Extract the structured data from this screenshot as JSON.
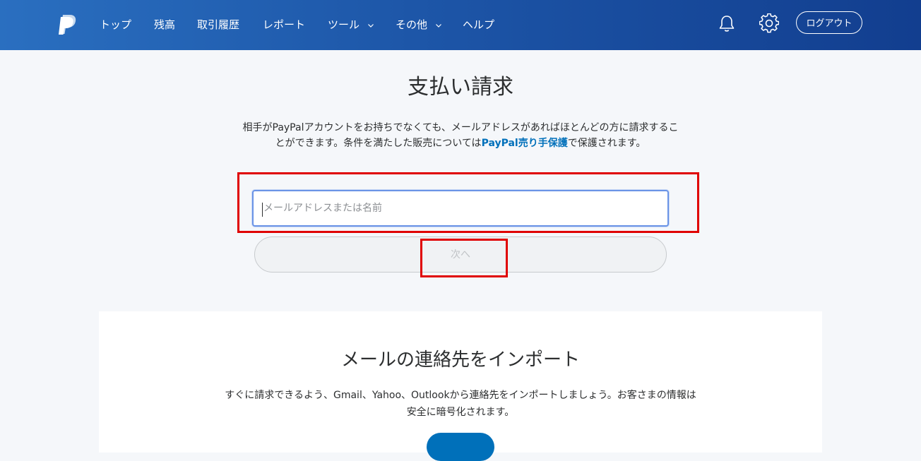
{
  "header": {
    "nav": [
      {
        "label": "トップ",
        "has_dropdown": false
      },
      {
        "label": "残高",
        "has_dropdown": false
      },
      {
        "label": "取引履歴",
        "has_dropdown": false
      },
      {
        "label": "レポート",
        "has_dropdown": false
      },
      {
        "label": "ツール",
        "has_dropdown": true
      },
      {
        "label": "その他",
        "has_dropdown": true
      },
      {
        "label": "ヘルプ",
        "has_dropdown": false
      }
    ],
    "icons": [
      "paypal-logo-icon",
      "bell-icon",
      "gear-icon",
      "chevron-down-icon"
    ],
    "logout_label": "ログアウト"
  },
  "main": {
    "title": "支払い請求",
    "description_before_link": "相手がPayPalアカウントをお持ちでなくても、メールアドレスがあればほとんどの方に請求することができます。条件を満たした販売については",
    "link_text_bold": "PayPal",
    "link_text_rest": "売り手保護",
    "description_after_link": "で保護されます。",
    "email_input": {
      "placeholder": "メールアドレスまたは名前",
      "value": ""
    },
    "next_label": "次へ"
  },
  "import_section": {
    "title": "メールの連絡先をインポート",
    "description": "すぐに請求できるよう、Gmail、Yahoo、Outlookから連絡先をインポートしましょう。お客さまの情報は安全に暗号化されます。"
  },
  "colors": {
    "header_gradient_start": "#2a6fc0",
    "header_gradient_end": "#123e8f",
    "link": "#0070ba",
    "highlight_box": "#e00000",
    "input_focus_border": "#6b94e6"
  }
}
